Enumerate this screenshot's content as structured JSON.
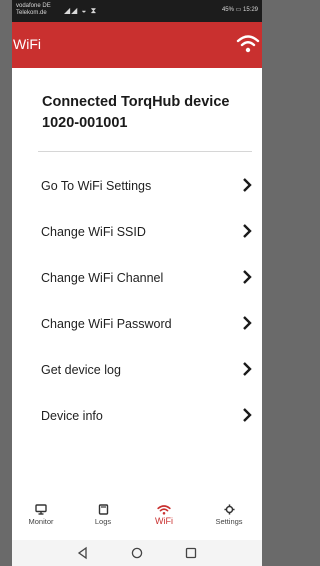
{
  "status_bar": {
    "carrier_line1": "vodafone DE",
    "carrier_line2": "Telekom.de",
    "battery": "45%",
    "time": "15:29"
  },
  "header": {
    "title": "WiFi"
  },
  "device": {
    "name": "Connected TorqHub device",
    "id": "1020-001001"
  },
  "menu": {
    "items": [
      {
        "label": "Go To WiFi Settings"
      },
      {
        "label": "Change WiFi SSID"
      },
      {
        "label": "Change WiFi Channel"
      },
      {
        "label": "Change WiFi Password"
      },
      {
        "label": "Get device log"
      },
      {
        "label": "Device info"
      }
    ]
  },
  "bottom_nav": {
    "items": [
      {
        "label": "Monitor",
        "icon": "monitor-icon"
      },
      {
        "label": "Logs",
        "icon": "logs-icon"
      },
      {
        "label": "WiFi",
        "icon": "wifi-icon",
        "active": true
      },
      {
        "label": "Settings",
        "icon": "gear-icon"
      }
    ]
  },
  "colors": {
    "accent": "#c9302f",
    "background": "#ffffff",
    "text": "#1a1a1a"
  }
}
